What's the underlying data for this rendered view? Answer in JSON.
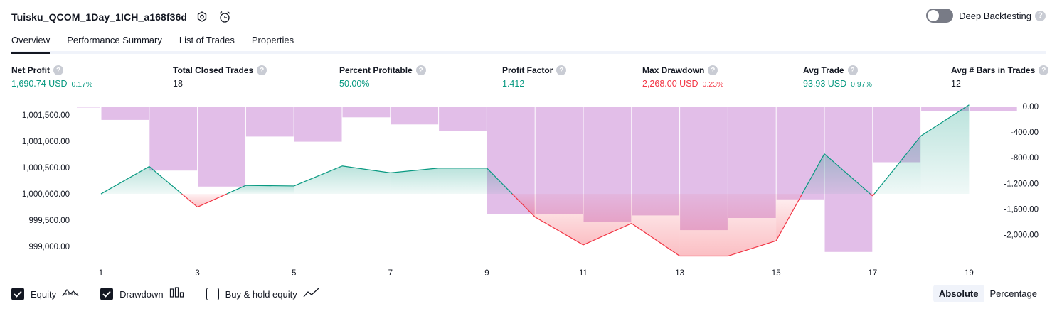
{
  "header": {
    "title": "Tuisku_QCOM_1Day_1ICH_a168f36d",
    "deep_backtesting_label": "Deep Backtesting"
  },
  "tabs": [
    {
      "label": "Overview",
      "active": true
    },
    {
      "label": "Performance Summary",
      "active": false
    },
    {
      "label": "List of Trades",
      "active": false
    },
    {
      "label": "Properties",
      "active": false
    }
  ],
  "metrics": [
    {
      "label": "Net Profit",
      "value": "1,690.74 USD",
      "pct": "0.17%",
      "color": "green"
    },
    {
      "label": "Total Closed Trades",
      "value": "18",
      "pct": "",
      "color": "neutral"
    },
    {
      "label": "Percent Profitable",
      "value": "50.00%",
      "pct": "",
      "color": "green"
    },
    {
      "label": "Profit Factor",
      "value": "1.412",
      "pct": "",
      "color": "green"
    },
    {
      "label": "Max Drawdown",
      "value": "2,268.00 USD",
      "pct": "0.23%",
      "color": "red"
    },
    {
      "label": "Avg Trade",
      "value": "93.93 USD",
      "pct": "0.97%",
      "color": "green"
    },
    {
      "label": "Avg # Bars in Trades",
      "value": "12",
      "pct": "",
      "color": "neutral"
    }
  ],
  "chart_data": {
    "type": "line",
    "x_ticks": [
      "1",
      "3",
      "5",
      "7",
      "9",
      "11",
      "13",
      "15",
      "17",
      "19"
    ],
    "left_axis": {
      "ticks": [
        "1,001,500.00",
        "1,001,000.00",
        "1,000,500.00",
        "1,000,000.00",
        "999,500.00",
        "999,000.00"
      ],
      "range": [
        998800,
        1001660
      ]
    },
    "right_axis": {
      "ticks": [
        "0.00",
        "-400.00",
        "-800.00",
        "-1,200.00",
        "-1,600.00",
        "-2,000.00"
      ],
      "range": [
        -2350,
        0
      ]
    },
    "baseline": 1000000,
    "series": [
      {
        "name": "Equity",
        "x": [
          1,
          2,
          3,
          4,
          5,
          6,
          7,
          8,
          9,
          10,
          11,
          12,
          13,
          14,
          15,
          16,
          17,
          18,
          19
        ],
        "values": [
          1000000,
          1000520,
          999750,
          1000160,
          1000150,
          1000530,
          1000400,
          1000490,
          1000490,
          999560,
          999030,
          999440,
          998820,
          998820,
          999110,
          1000760,
          999960,
          1001100,
          1001690
        ]
      },
      {
        "name": "Drawdown",
        "x": [
          1,
          2,
          3,
          4,
          5,
          6,
          7,
          8,
          9,
          10,
          11,
          12,
          13,
          14,
          15,
          16,
          17,
          18,
          19,
          20
        ],
        "values": [
          -10,
          -210,
          -1000,
          -1250,
          -470,
          -550,
          -170,
          -280,
          -380,
          -1680,
          -1680,
          -1800,
          -1700,
          -1930,
          -1740,
          -1450,
          -2270,
          -870,
          -70,
          -70
        ]
      }
    ],
    "colors": {
      "equity_up": "#089981",
      "equity_down": "#f23645",
      "drawdown": "#ce93d8"
    }
  },
  "legend": [
    {
      "label": "Equity",
      "checked": true,
      "icon": "equity-line-icon"
    },
    {
      "label": "Drawdown",
      "checked": true,
      "icon": "drawdown-bars-icon"
    },
    {
      "label": "Buy & hold equity",
      "checked": false,
      "icon": "buy-hold-line-icon"
    }
  ],
  "modes": [
    {
      "label": "Absolute",
      "active": true
    },
    {
      "label": "Percentage",
      "active": false
    }
  ]
}
